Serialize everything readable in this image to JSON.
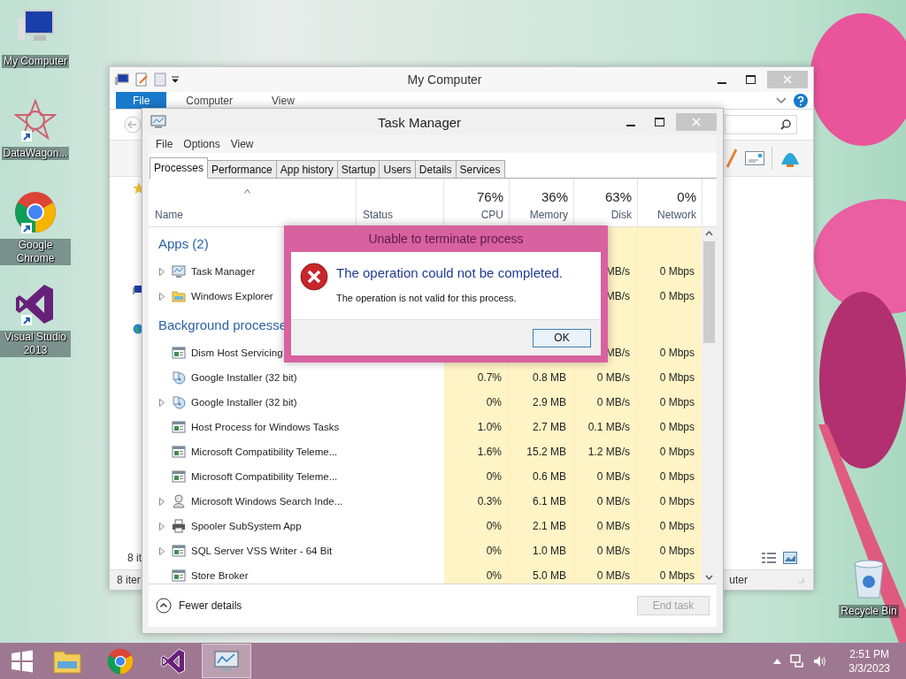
{
  "desktop_icons": [
    {
      "label": "My Computer",
      "kind": "computer"
    },
    {
      "label": "DataWagon...",
      "kind": "datawagon"
    },
    {
      "label": "Google Chrome",
      "kind": "chrome"
    },
    {
      "label": "Visual Studio 2013",
      "kind": "vs"
    }
  ],
  "recycle_bin": {
    "label": "Recycle Bin"
  },
  "explorer": {
    "title": "My Computer",
    "ribbon_tabs": [
      {
        "label": "File",
        "selected": true
      },
      {
        "label": "Computer",
        "selected": false
      },
      {
        "label": "View",
        "selected": false
      }
    ],
    "item_count": "8 it",
    "status_left": "8 iter",
    "status_right": "uter"
  },
  "task_manager": {
    "title": "Task Manager",
    "menu": [
      "File",
      "Options",
      "View"
    ],
    "tabs": [
      {
        "label": "Processes",
        "selected": true
      },
      {
        "label": "Performance",
        "selected": false
      },
      {
        "label": "App history",
        "selected": false
      },
      {
        "label": "Startup",
        "selected": false
      },
      {
        "label": "Users",
        "selected": false
      },
      {
        "label": "Details",
        "selected": false
      },
      {
        "label": "Services",
        "selected": false
      }
    ],
    "columns": [
      {
        "label": "Name",
        "kind": "name"
      },
      {
        "label": "Status",
        "kind": "status"
      },
      {
        "label": "CPU",
        "usage": "76%",
        "kind": "metric"
      },
      {
        "label": "Memory",
        "usage": "36%",
        "kind": "metric"
      },
      {
        "label": "Disk",
        "usage": "63%",
        "kind": "metric"
      },
      {
        "label": "Network",
        "usage": "0%",
        "kind": "metric"
      }
    ],
    "groups": [
      {
        "label": "Apps (2)",
        "rows": [
          {
            "name": "Task Manager",
            "kind": "monitor",
            "expandable": true,
            "disk": "MB/s",
            "network": "0 Mbps"
          },
          {
            "name": "Windows Explorer",
            "kind": "folder",
            "expandable": true,
            "disk": "MB/s",
            "network": "0 Mbps"
          }
        ]
      },
      {
        "label": "Background processe",
        "rows": [
          {
            "name": "Dism Host Servicing",
            "kind": "service",
            "expandable": false,
            "disk": "MB/s",
            "network": "0 Mbps"
          },
          {
            "name": "Google Installer (32 bit)",
            "kind": "installer",
            "expandable": false,
            "cpu": "0.7%",
            "memory": "0.8 MB",
            "disk": "0 MB/s",
            "network": "0 Mbps"
          },
          {
            "name": "Google Installer (32 bit)",
            "kind": "installer",
            "expandable": true,
            "cpu": "0%",
            "memory": "2.9 MB",
            "disk": "0 MB/s",
            "network": "0 Mbps"
          },
          {
            "name": "Host Process for Windows Tasks",
            "kind": "service",
            "expandable": false,
            "cpu": "1.0%",
            "memory": "2.7 MB",
            "disk": "0.1 MB/s",
            "network": "0 Mbps"
          },
          {
            "name": "Microsoft Compatibility Teleme...",
            "kind": "service",
            "expandable": false,
            "cpu": "1.6%",
            "memory": "15.2 MB",
            "disk": "1.2 MB/s",
            "network": "0 Mbps"
          },
          {
            "name": "Microsoft Compatibility Teleme...",
            "kind": "service",
            "expandable": false,
            "cpu": "0%",
            "memory": "0.6 MB",
            "disk": "0 MB/s",
            "network": "0 Mbps"
          },
          {
            "name": "Microsoft Windows Search Inde...",
            "kind": "search",
            "expandable": true,
            "cpu": "0.3%",
            "memory": "6.1 MB",
            "disk": "0 MB/s",
            "network": "0 Mbps"
          },
          {
            "name": "Spooler SubSystem App",
            "kind": "printer",
            "expandable": true,
            "cpu": "0%",
            "memory": "2.1 MB",
            "disk": "0 MB/s",
            "network": "0 Mbps"
          },
          {
            "name": "SQL Server VSS Writer - 64 Bit",
            "kind": "service",
            "expandable": true,
            "cpu": "0%",
            "memory": "1.0 MB",
            "disk": "0 MB/s",
            "network": "0 Mbps"
          },
          {
            "name": "Store Broker",
            "kind": "service",
            "expandable": false,
            "cpu": "0%",
            "memory": "5.0 MB",
            "disk": "0 MB/s",
            "network": "0 Mbps"
          }
        ]
      }
    ],
    "fewer_details": "Fewer details",
    "end_task": {
      "label": "End task",
      "disabled": true
    }
  },
  "dialog": {
    "title": "Unable to terminate process",
    "message": "The operation could not be completed.",
    "detail": "The operation is not valid for this process.",
    "button": "OK"
  },
  "taskbar": {
    "apps": [
      {
        "kind": "explorer",
        "selected": false
      },
      {
        "kind": "chrome",
        "selected": false
      },
      {
        "kind": "vs",
        "selected": false
      },
      {
        "kind": "taskmgr",
        "selected": true
      }
    ],
    "clock": {
      "time": "2:51 PM",
      "date": "3/3/2023"
    }
  }
}
